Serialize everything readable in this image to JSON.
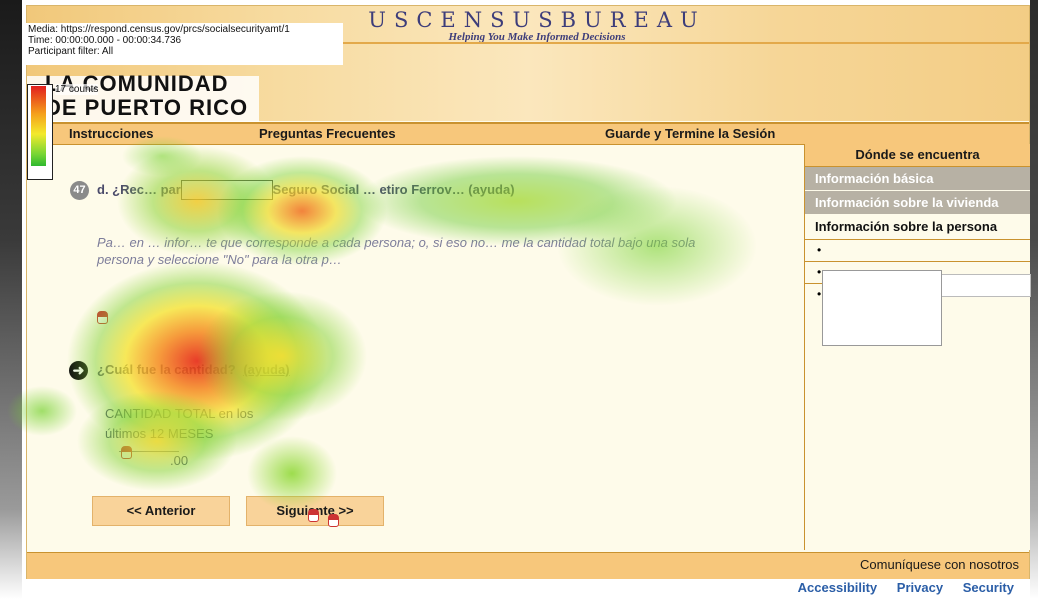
{
  "overlay": {
    "media": "Media: https://respond.census.gov/prcs/socialsecurityamt/1",
    "time": "Time: 00:00:00.000 - 00:00:34.736",
    "filter": "Participant filter: All",
    "legend_label": "17 counts",
    "colors": {
      "high": "#e21e1e",
      "mid": "#f3ea2c",
      "low": "#2fb82f"
    }
  },
  "header": {
    "title": "USCENSUSBUREAU",
    "subtitle": "Helping You Make Informed Decisions",
    "community_line1": "LA COMUNIDAD",
    "community_line2": "DE PUERTO RICO"
  },
  "nav": {
    "instructions": "Instrucciones",
    "faq": "Preguntas Frecuentes",
    "save_exit": "Guarde y Termine la Sesión"
  },
  "sidebar": {
    "heading": "Dónde se encuentra",
    "items": [
      {
        "label": "Información básica"
      },
      {
        "label": "Información sobre la vivienda"
      },
      {
        "label": "Información sobre la persona"
      }
    ],
    "bullets": [
      "•",
      "•",
      "•"
    ]
  },
  "question": {
    "number": "47",
    "text": "d. ¿Rec… para el ¿… ito del Seguro Social … etiro Ferrov… (ayuda)",
    "instructions": "Pa… en … infor… te que corresponde a cada persona; o, si eso no… me la cantidad total bajo una sola persona y seleccione \"No\" para la otra p…",
    "amount_question": "¿Cuál fue la cantidad?",
    "help": "(ayuda)",
    "amount_label_line1": "CANTIDAD TOTAL en los",
    "amount_label_line2": "últimos 12 MESES",
    "amount_value": ".00"
  },
  "buttons": {
    "previous": "<< Anterior",
    "next": "Siguiente >>"
  },
  "footer": {
    "contact": "Comuníquese con nosotros",
    "accessibility": "Accessibility",
    "privacy": "Privacy",
    "security": "Security"
  }
}
